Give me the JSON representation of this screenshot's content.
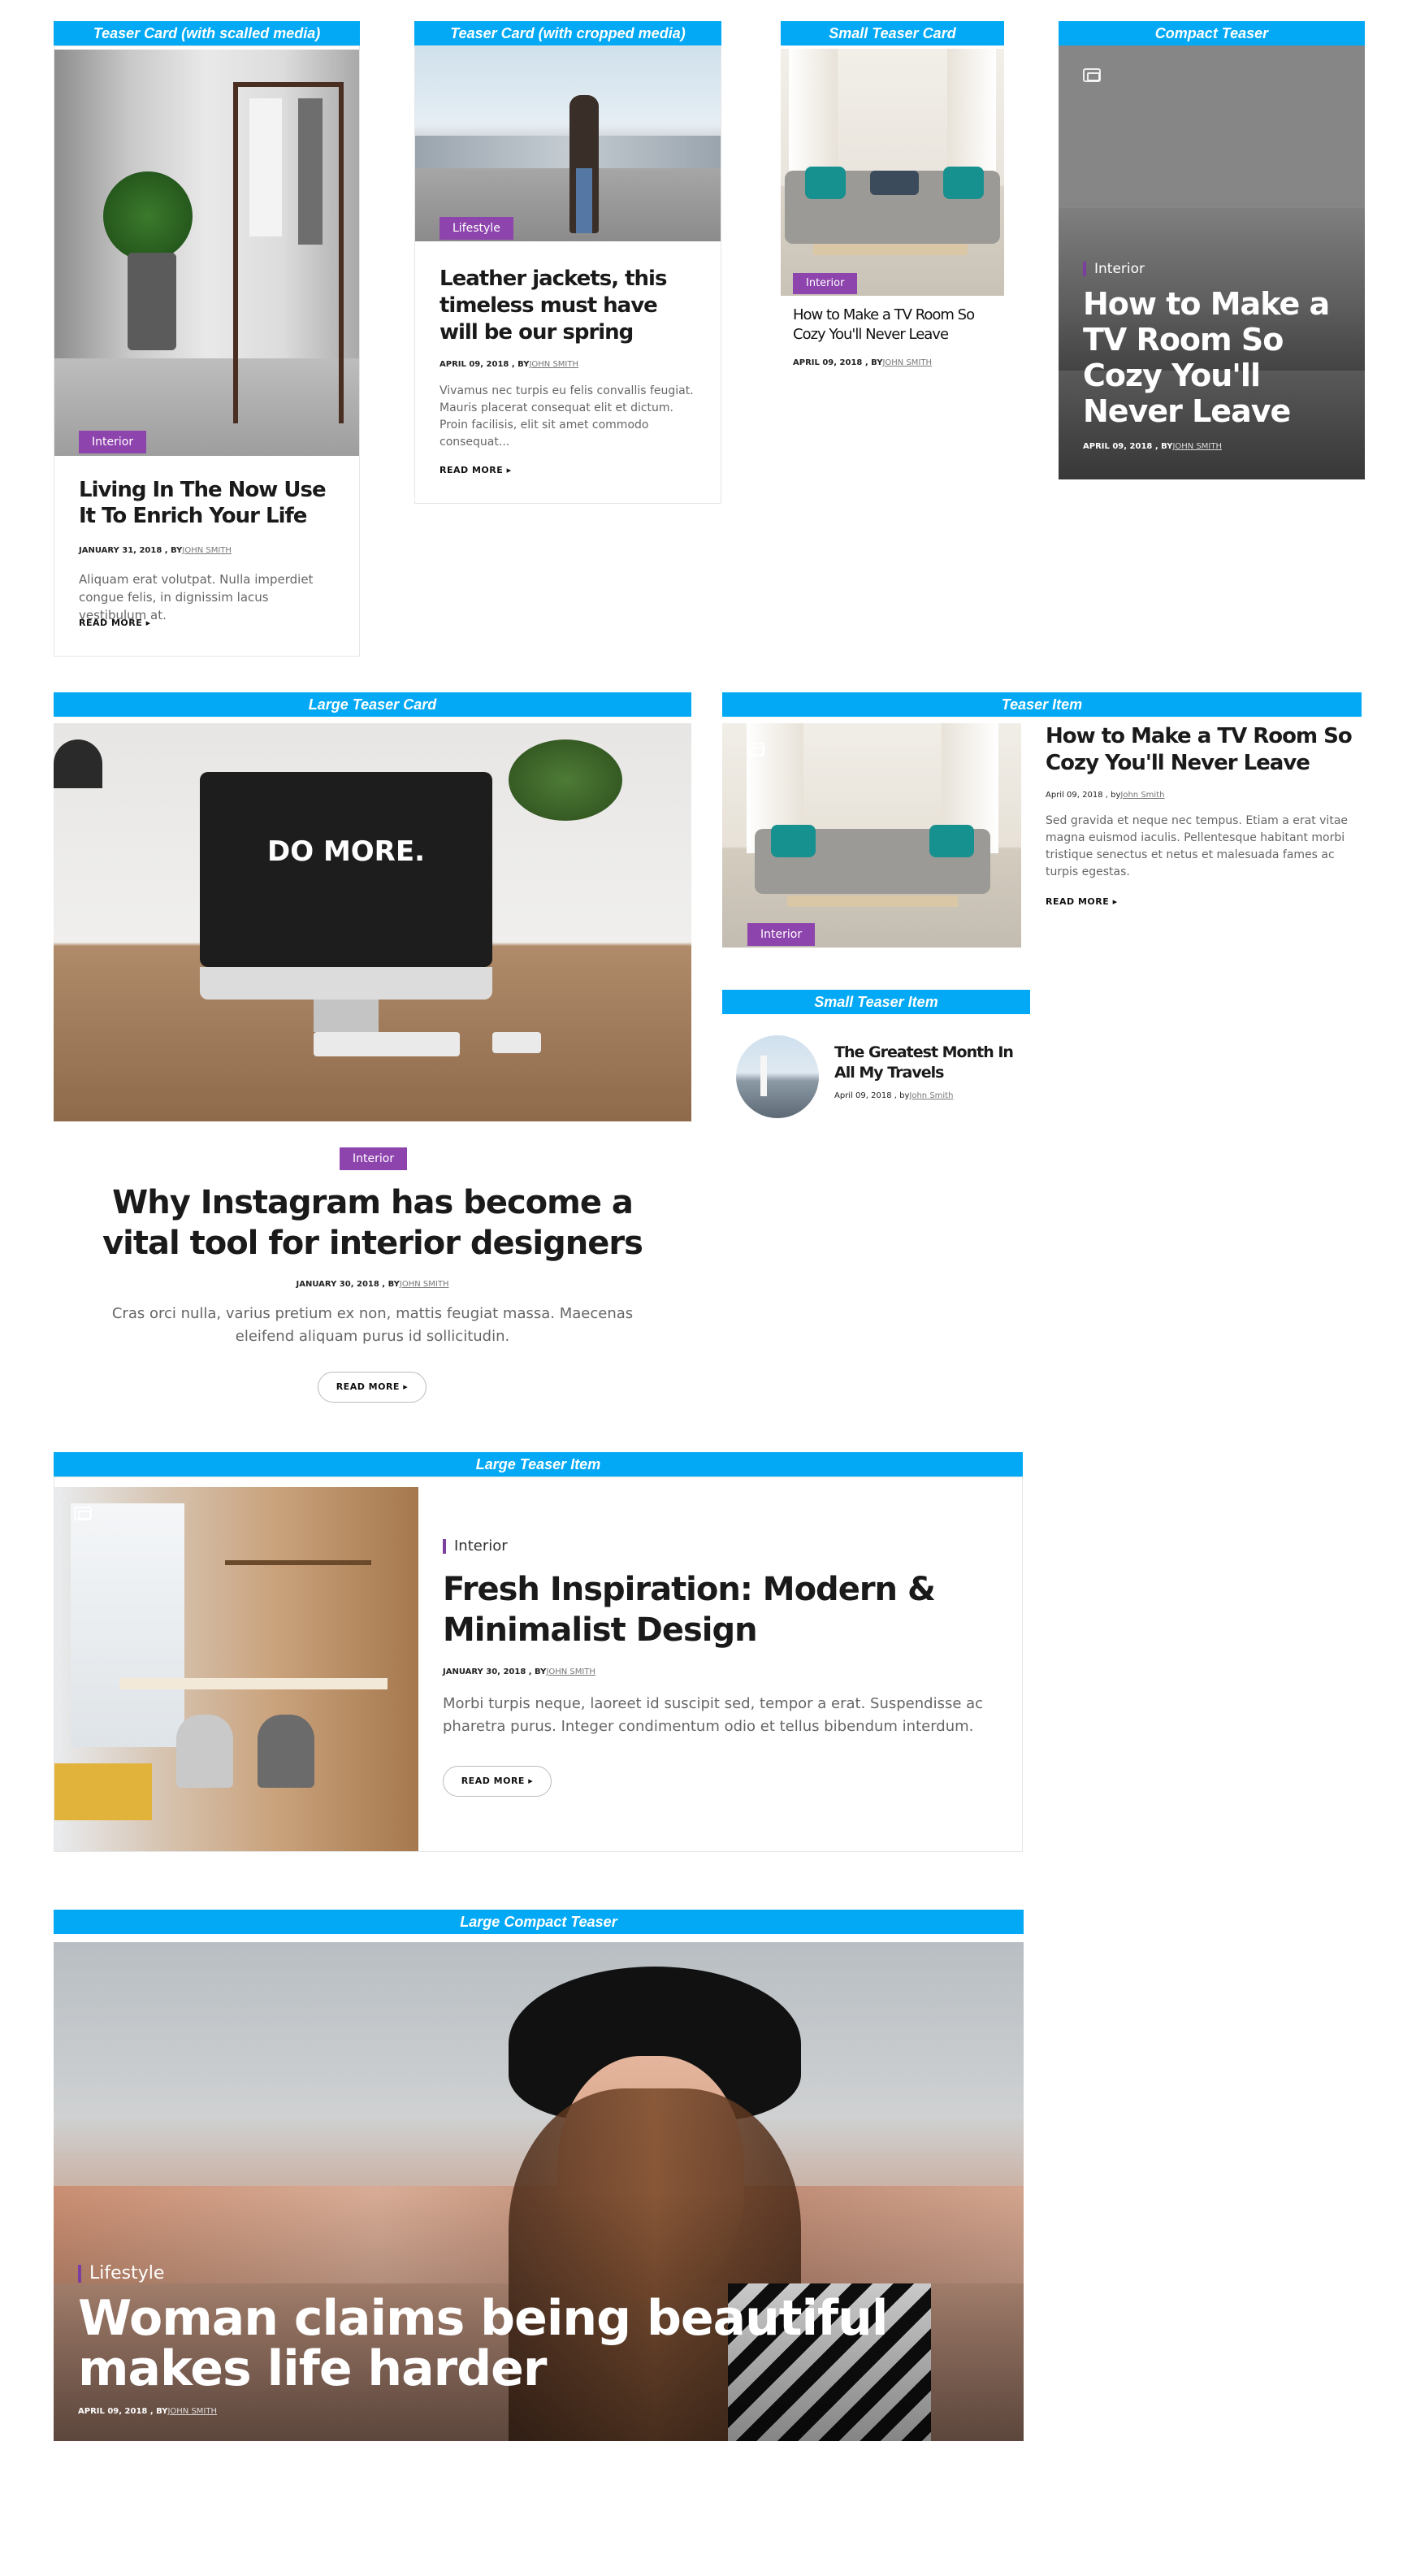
{
  "labels": {
    "teaser_card_scaled": "Teaser Card (with scalled media)",
    "teaser_card_cropped": "Teaser Card (with cropped media)",
    "small_teaser_card": "Small Teaser Card",
    "compact_teaser": "Compact Teaser",
    "large_teaser_card": "Large Teaser Card",
    "teaser_item": "Teaser Item",
    "small_teaser_item": "Small Teaser Item",
    "large_teaser_item": "Large Teaser Item",
    "large_compact_teaser": "Large Compact Teaser"
  },
  "card1": {
    "category": "Interior",
    "title": "Living In The Now Use It To Enrich Your Life",
    "date": "JANUARY 31, 2018",
    "by": " , BY",
    "author": "JOHN SMITH",
    "excerpt": "Aliquam erat volutpat. Nulla imperdiet congue felis, in dignissim lacus vestibulum at.",
    "read_more": "READ MORE ▸"
  },
  "card2": {
    "category": "Lifestyle",
    "title": "Leather jackets, this timeless must have will be our spring",
    "date": "APRIL 09, 2018",
    "by": " , BY",
    "author": "JOHN SMITH",
    "excerpt": "Vivamus nec turpis eu felis convallis feugiat. Mauris placerat consequat elit et dictum. Proin facilisis, elit sit amet commodo consequat...",
    "read_more": "READ MORE ▸"
  },
  "small_card": {
    "category": "Interior",
    "title": "How to Make a TV Room So Cozy You'll Never Leave",
    "date": "APRIL 09, 2018",
    "by": " , BY",
    "author": "JOHN SMITH"
  },
  "compact": {
    "category": "Interior",
    "title": "How to Make a TV Room So Cozy You'll Never Leave",
    "date": "APRIL 09, 2018",
    "by": " , BY",
    "author": "JOHN SMITH"
  },
  "large_card": {
    "image_text": "DO MORE.",
    "category": "Interior",
    "title": "Why Instagram has become a vital tool for interior designers",
    "date": "JANUARY 30, 2018",
    "by": " , BY",
    "author": "JOHN SMITH",
    "excerpt": "Cras orci nulla, varius pretium ex non, mattis feugiat massa. Maecenas eleifend aliquam purus id sollicitudin.",
    "read_more": "READ MORE ▸"
  },
  "teaser_item": {
    "category": "Interior",
    "title": "How to Make a TV Room So Cozy You'll Never Leave",
    "date": "April 09, 2018",
    "by": " , by",
    "author": "John Smith",
    "excerpt": "Sed gravida et neque nec tempus. Etiam a erat vitae magna euismod iaculis. Pellentesque habitant morbi tristique senectus et netus et malesuada fames ac turpis egestas.",
    "read_more": "READ MORE ▸"
  },
  "small_item": {
    "title": "The Greatest Month In All My Travels",
    "date": "April 09, 2018",
    "by": " , by",
    "author": "John Smith"
  },
  "large_item": {
    "category": "Interior",
    "title": "Fresh Inspiration: Modern & Minimalist Design",
    "date": "JANUARY 30, 2018",
    "by": " , BY",
    "author": "JOHN SMITH",
    "excerpt": "Morbi turpis neque, laoreet id suscipit sed, tempor a erat. Suspendisse ac pharetra purus. Integer condimentum odio et tellus bibendum interdum.",
    "read_more": "READ MORE ▸"
  },
  "large_compact": {
    "category": "Lifestyle",
    "title": "Woman claims being beautiful makes life harder",
    "date": "APRIL 09, 2018",
    "by": " , BY",
    "author": "JOHN SMITH"
  },
  "colors": {
    "label_bar": "#03a9f4",
    "category_badge": "#8e44ad",
    "accent_bar": "#7b3fa0"
  }
}
